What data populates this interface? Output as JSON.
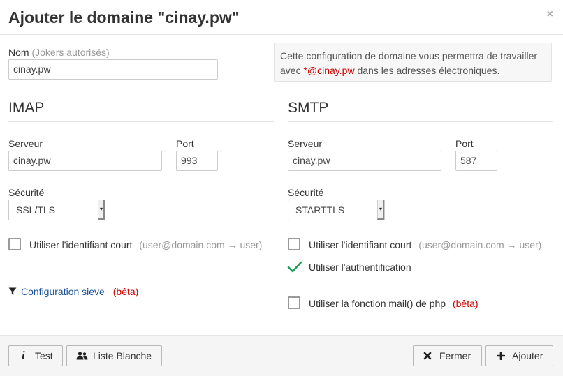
{
  "dialog": {
    "title": "Ajouter le domaine \"cinay.pw\"",
    "close_glyph": "×"
  },
  "name_field": {
    "label": "Nom",
    "hint": "(Jokers autorisés)",
    "value": "cinay.pw"
  },
  "info": {
    "text_before": "Cette configuration de domaine vous permettra de travailler avec",
    "highlight": "*@cinay.pw",
    "text_after": "dans les adresses électroniques."
  },
  "imap": {
    "title": "IMAP",
    "server_label": "Serveur",
    "server_value": "cinay.pw",
    "port_label": "Port",
    "port_value": "993",
    "security_label": "Sécurité",
    "security_value": "SSL/TLS",
    "short_login_label": "Utiliser l'identifiant court",
    "short_login_hint": "(user@domain.com → user)",
    "short_login_checked": false
  },
  "smtp": {
    "title": "SMTP",
    "server_label": "Serveur",
    "server_value": "cinay.pw",
    "port_label": "Port",
    "port_value": "587",
    "security_label": "Sécurité",
    "security_value": "STARTTLS",
    "short_login_label": "Utiliser l'identifiant court",
    "short_login_hint": "(user@domain.com → user)",
    "short_login_checked": false,
    "auth_label": "Utiliser l'authentification",
    "auth_checked": true,
    "php_mail_label": "Utiliser la fonction mail() de php",
    "php_mail_badge": "(bêta)",
    "php_mail_checked": false
  },
  "sieve": {
    "link_label": "Configuration sieve",
    "badge": "(bêta)"
  },
  "footer": {
    "test_label": "Test",
    "whitelist_label": "Liste Blanche",
    "close_label": "Fermer",
    "add_label": "Ajouter"
  },
  "colors": {
    "accent_red": "#cc0000",
    "link_blue": "#1a4f9c",
    "check_green": "#1e9e5a",
    "footer_bg": "#f5f5f5"
  },
  "icons": {
    "info": "info-icon",
    "users": "users-icon",
    "close": "times-icon",
    "add": "plus-icon",
    "filter": "filter-icon",
    "check": "check-icon"
  }
}
